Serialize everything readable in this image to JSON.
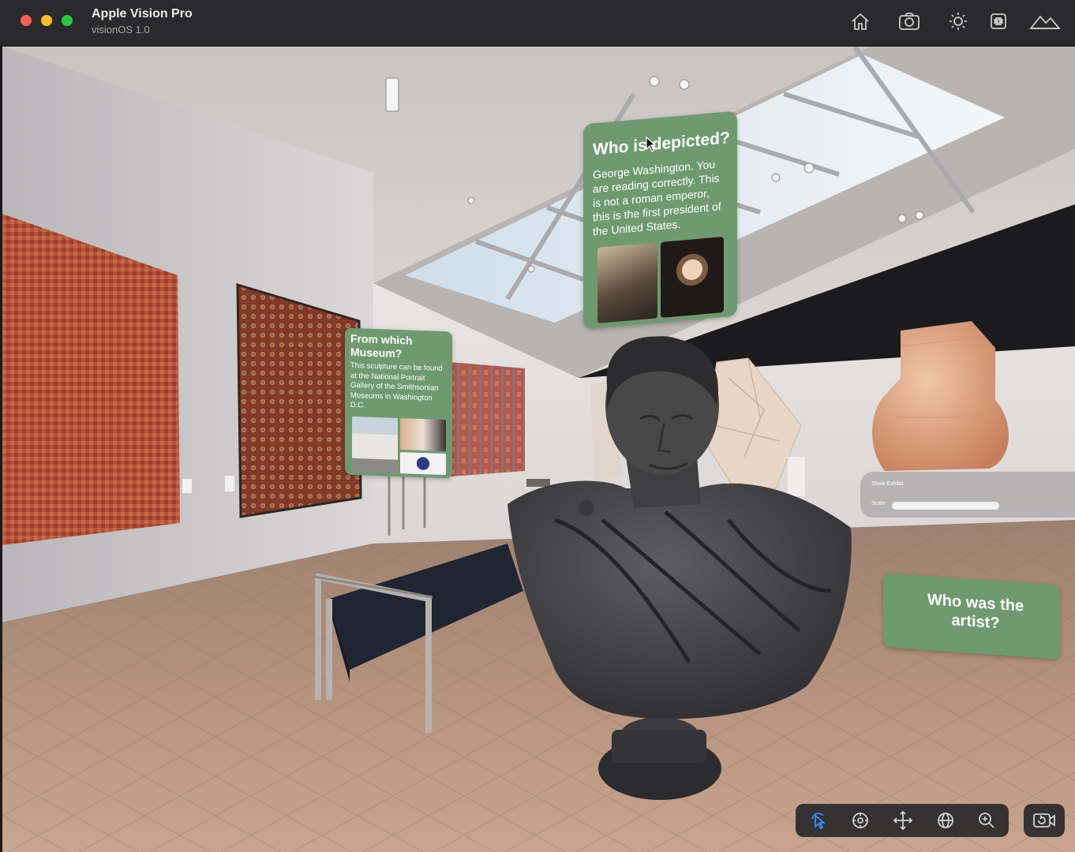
{
  "window": {
    "title": "Apple Vision Pro",
    "subtitle": "visionOS 1.0"
  },
  "titlebar_icons": [
    "home-icon",
    "camera-icon",
    "brightness-icon",
    "command-icon",
    "environment-icon"
  ],
  "panels": {
    "who_depicted": {
      "title": "Who is depicted?",
      "body": "George Washington. You are reading correctly. This is not a roman emperor, this is the first president of the United States."
    },
    "museum": {
      "title": "From which Museum?",
      "body": "This sculpture can be found at the National Portrait Gallery of the Smithsonian Museums in Washington D.C."
    },
    "artist": {
      "title": "Who was the artist?"
    }
  },
  "exhibit_controls": {
    "show_label": "Show Exhibit",
    "scale_label": "Scale"
  },
  "toolbar_icons": [
    "select-cursor-icon",
    "orbit-icon",
    "pan-move-icon",
    "globe-icon",
    "zoom-icon"
  ],
  "camera_button_icon": "video-camera-icon",
  "colors": {
    "panel_green": "#6f9a70",
    "accent_blue": "#3a8dff"
  }
}
